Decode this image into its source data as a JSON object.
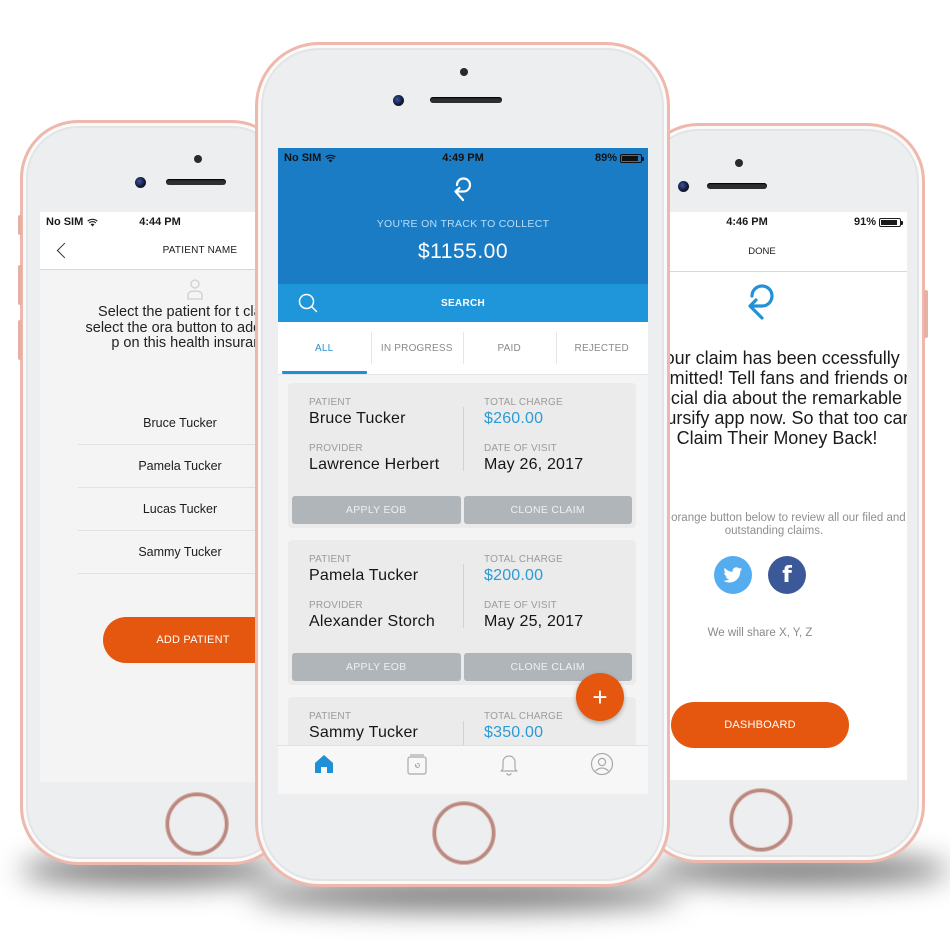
{
  "left_phone": {
    "status": {
      "carrier": "No SIM",
      "time": "4:44 PM"
    },
    "header": {
      "title": "PATIENT NAME",
      "back_icon": "chevron-left-icon"
    },
    "instructions": "Select the patient for this claim...or select the orange button to add another patient on this health insurance plan",
    "instructions_visible": "Select the patient for t claim...or select the ora button to add another p on this health insurance p",
    "patients": [
      {
        "name": "Bruce Tucker"
      },
      {
        "name": "Pamela  Tucker"
      },
      {
        "name": "Lucas Tucker"
      },
      {
        "name": "Sammy Tucker"
      }
    ],
    "add_patient_label": "ADD PATIENT"
  },
  "center_phone": {
    "status": {
      "carrier": "No SIM",
      "time": "4:49 PM",
      "battery": "89%",
      "battery_level": 0.89
    },
    "hero": {
      "tagline": "YOU'RE ON TRACK TO COLLECT",
      "amount": "$1155.00"
    },
    "search": {
      "label": "SEARCH"
    },
    "tabs": [
      {
        "label": "ALL",
        "active": true
      },
      {
        "label": "IN PROGRESS",
        "active": false
      },
      {
        "label": "PAID",
        "active": false
      },
      {
        "label": "REJECTED",
        "active": false
      }
    ],
    "claim_labels": {
      "patient": "PATIENT",
      "provider": "PROVIDER",
      "total_charge": "TOTAL CHARGE",
      "date_of_visit": "DATE OF VISIT",
      "apply_eob": "APPLY EOB",
      "clone_claim": "CLONE CLAIM"
    },
    "claims": [
      {
        "patient": "Bruce Tucker",
        "provider": "Lawrence Herbert",
        "total_charge": "$260.00",
        "date_of_visit": "May 26, 2017"
      },
      {
        "patient": "Pamela  Tucker",
        "provider": "Alexander Storch",
        "total_charge": "$200.00",
        "date_of_visit": "May 25, 2017"
      },
      {
        "patient": "Sammy Tucker",
        "provider": "",
        "total_charge": "$350.00",
        "date_of_visit": ""
      }
    ],
    "fab_label": "+",
    "bottom_nav": [
      {
        "icon": "home-icon",
        "active": true
      },
      {
        "icon": "claims-archive-icon",
        "active": false
      },
      {
        "icon": "bell-icon",
        "active": false
      },
      {
        "icon": "profile-icon",
        "active": false
      }
    ]
  },
  "right_phone": {
    "status": {
      "time": "4:46 PM",
      "battery": "91%",
      "battery_level": 0.91
    },
    "header": {
      "title": "DONE"
    },
    "success_message": "Your claim has been successfully submitted! Tell your fans and friends on social media about the remarkable Reimbursify app now. So that they too can Claim Their Money Back!",
    "success_visible": "Your claim has been ccessfully submitted! Tell fans and friends on social dia about the remarkable mbursify app now. So that too can Claim Their Money Back!",
    "review_message": "Click on the orange button below to review all your filed and outstanding claims.",
    "review_visible": "n the orange button below to review all our filed and outstanding claims.",
    "share_buttons": [
      {
        "icon": "twitter-icon",
        "color": "#55acee"
      },
      {
        "icon": "facebook-icon",
        "color": "#3b5998",
        "glyph": "f"
      }
    ],
    "share_note": "We will share X, Y, Z",
    "dashboard_label": "DASHBOARD"
  },
  "colors": {
    "brand_blue": "#1a7cc4",
    "search_blue": "#1e96d9",
    "accent_orange": "#e5570f",
    "money_blue": "#2c9ad6",
    "phone_rose_gold": "#efb8ac"
  }
}
